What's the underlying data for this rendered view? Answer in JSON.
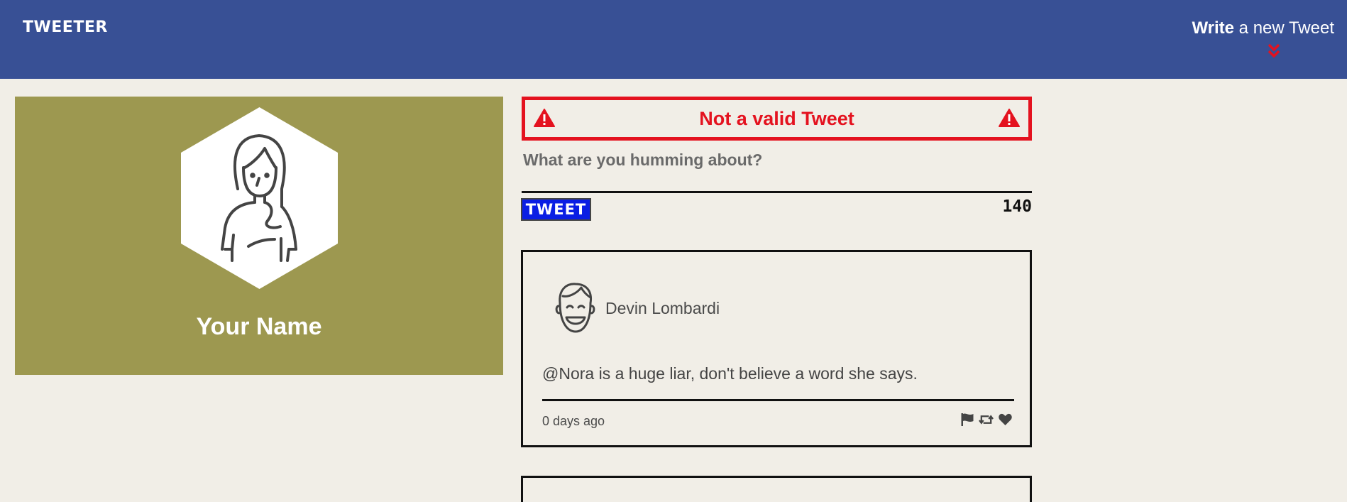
{
  "nav": {
    "brand": "TWEETER",
    "write_bold": "Write",
    "write_rest": " a new Tweet",
    "arrow_icon": "double-chevron-down-icon",
    "background": "#385095",
    "arrow_color": "#e4121f"
  },
  "profile": {
    "name": "Your Name",
    "avatar_icon": "woman-avatar-icon",
    "background": "#9d9850"
  },
  "compose": {
    "error": "Not a valid Tweet",
    "error_color": "#e4121f",
    "placeholder": "What are you humming about?",
    "button_label": "TWEET",
    "button_color": "#0a1ee4",
    "counter": "140"
  },
  "tweets": [
    {
      "author": "Devin Lombardi",
      "avatar_icon": "man-avatar-icon",
      "content": "@Nora is a huge liar, don't believe a word she says.",
      "time": "0 days ago",
      "actions": [
        "flag-icon",
        "retweet-icon",
        "heart-icon"
      ]
    }
  ]
}
